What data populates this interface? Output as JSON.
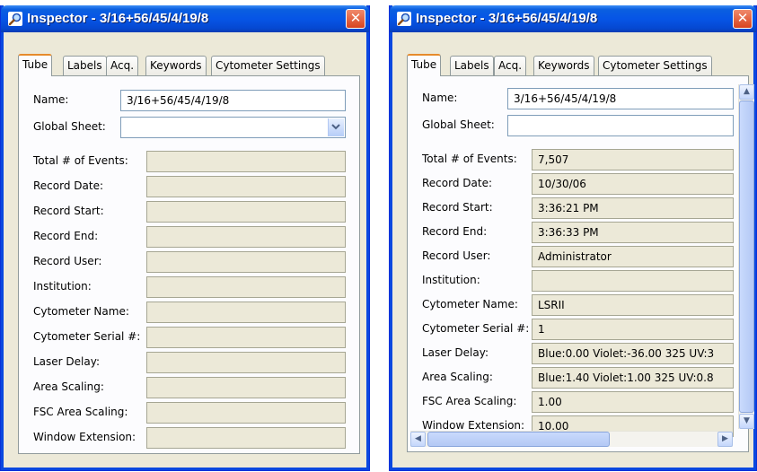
{
  "left_window": {
    "title": "Inspector - 3/16+56/45/4/19/8",
    "tabs": [
      "Tube",
      "Labels",
      "Acq.",
      "Keywords",
      "Cytometer Settings"
    ],
    "name_label": "Name:",
    "name_value": "3/16+56/45/4/19/8",
    "global_sheet_label": "Global Sheet:",
    "global_sheet_value": "",
    "fields": [
      {
        "label": "Total # of Events:",
        "value": ""
      },
      {
        "label": "Record Date:",
        "value": ""
      },
      {
        "label": "Record Start:",
        "value": ""
      },
      {
        "label": "Record End:",
        "value": ""
      },
      {
        "label": "Record User:",
        "value": ""
      },
      {
        "label": "Institution:",
        "value": ""
      },
      {
        "label": "Cytometer Name:",
        "value": ""
      },
      {
        "label": "Cytometer Serial #:",
        "value": ""
      },
      {
        "label": "Laser Delay:",
        "value": ""
      },
      {
        "label": "Area Scaling:",
        "value": ""
      },
      {
        "label": "FSC Area Scaling:",
        "value": ""
      },
      {
        "label": "Window Extension:",
        "value": ""
      }
    ]
  },
  "right_window": {
    "title": "Inspector - 3/16+56/45/4/19/8",
    "tabs": [
      "Tube",
      "Labels",
      "Acq.",
      "Keywords",
      "Cytometer Settings"
    ],
    "name_label": "Name:",
    "name_value": "3/16+56/45/4/19/8",
    "global_sheet_label": "Global Sheet:",
    "global_sheet_value": "",
    "fields": [
      {
        "label": "Total # of Events:",
        "value": "7,507"
      },
      {
        "label": "Record Date:",
        "value": "10/30/06"
      },
      {
        "label": "Record Start:",
        "value": "3:36:21 PM"
      },
      {
        "label": "Record End:",
        "value": "3:36:33 PM"
      },
      {
        "label": "Record User:",
        "value": "Administrator"
      },
      {
        "label": "Institution:",
        "value": ""
      },
      {
        "label": "Cytometer Name:",
        "value": "LSRII"
      },
      {
        "label": "Cytometer Serial #:",
        "value": "1"
      },
      {
        "label": "Laser Delay:",
        "value": "Blue:0.00  Violet:-36.00  325 UV:3"
      },
      {
        "label": "Area Scaling:",
        "value": "Blue:1.40  Violet:1.00  325 UV:0.8"
      },
      {
        "label": "FSC Area Scaling:",
        "value": "1.00"
      },
      {
        "label": "Window Extension:",
        "value": "10.00"
      }
    ]
  },
  "icons": {
    "title_icon": "magnifier-icon",
    "close_glyph": "✕",
    "dropdown_glyph": "chevron-down-icon",
    "scroll_up_glyph": "▲",
    "scroll_down_glyph": "▼",
    "scroll_left_glyph": "◀",
    "scroll_right_glyph": "▶"
  },
  "colors": {
    "titlebar": "#0655e6",
    "close_button": "#d8431f",
    "window_body": "#ece9d8",
    "active_tab_accent": "#e68b2c"
  }
}
